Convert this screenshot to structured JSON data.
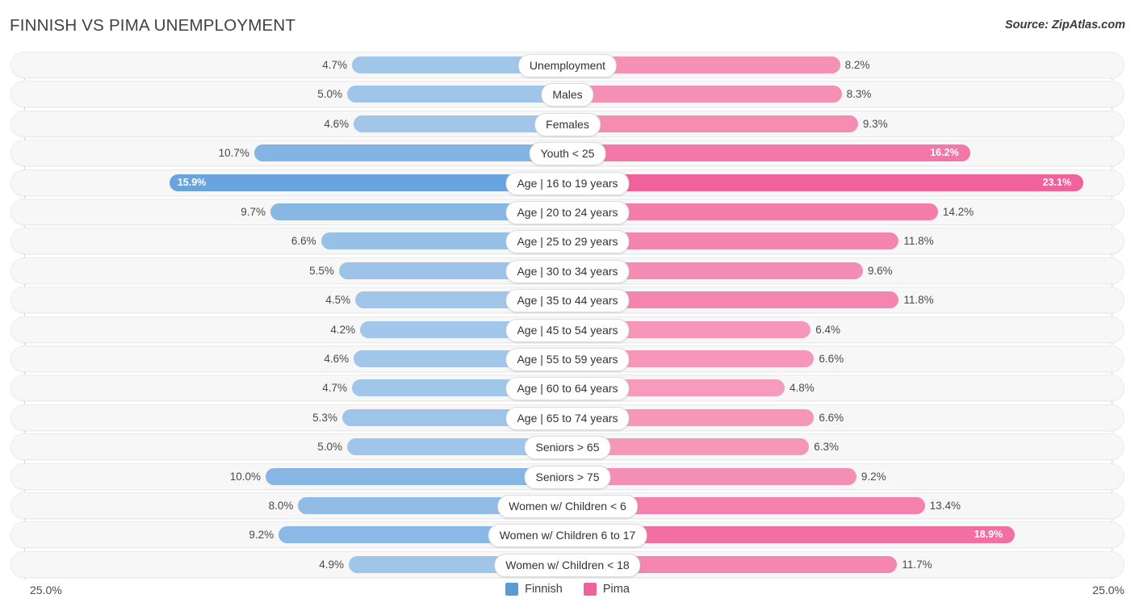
{
  "header": {
    "title": "FINNISH VS PIMA UNEMPLOYMENT",
    "source": "Source: ZipAtlas.com"
  },
  "axis": {
    "min_label": "25.0%",
    "max_label": "25.0%"
  },
  "legend": {
    "items": [
      {
        "label": "Finnish",
        "color": "#5b9bd5"
      },
      {
        "label": "Pima",
        "color": "#f0629a"
      }
    ]
  },
  "colors": {
    "finnish_light": "#a4c8ea",
    "finnish_dark": "#6aa4de",
    "pima_light": "#f79ebd",
    "pima_dark": "#f0629a",
    "track": "#f7f7f7",
    "pill": "#ffffff"
  },
  "chart_data": {
    "type": "bar",
    "title": "FINNISH VS PIMA UNEMPLOYMENT",
    "subtitle": "",
    "orientation": "horizontal-diverging",
    "xlabel": "",
    "ylabel": "",
    "xlim": [
      25.0,
      25.0
    ],
    "grid": false,
    "legend_position": "bottom-center",
    "categories": [
      "Unemployment",
      "Males",
      "Females",
      "Youth < 25",
      "Age | 16 to 19 years",
      "Age | 20 to 24 years",
      "Age | 25 to 29 years",
      "Age | 30 to 34 years",
      "Age | 35 to 44 years",
      "Age | 45 to 54 years",
      "Age | 55 to 59 years",
      "Age | 60 to 64 years",
      "Age | 65 to 74 years",
      "Seniors > 65",
      "Seniors > 75",
      "Women w/ Children < 6",
      "Women w/ Children 6 to 17",
      "Women w/ Children < 18"
    ],
    "series": [
      {
        "name": "Finnish",
        "values": [
          4.7,
          5.0,
          4.6,
          10.7,
          15.9,
          9.7,
          6.6,
          5.5,
          4.5,
          4.2,
          4.6,
          4.7,
          5.3,
          5.0,
          10.0,
          8.0,
          9.2,
          4.9
        ],
        "labels": [
          "4.7%",
          "5.0%",
          "4.6%",
          "10.7%",
          "15.9%",
          "9.7%",
          "6.6%",
          "5.5%",
          "4.5%",
          "4.2%",
          "4.6%",
          "4.7%",
          "5.3%",
          "5.0%",
          "10.0%",
          "8.0%",
          "9.2%",
          "4.9%"
        ]
      },
      {
        "name": "Pima",
        "values": [
          8.2,
          8.3,
          9.3,
          16.2,
          23.1,
          14.2,
          11.8,
          9.6,
          11.8,
          6.4,
          6.6,
          4.8,
          6.6,
          6.3,
          9.2,
          13.4,
          18.9,
          11.7
        ],
        "labels": [
          "8.2%",
          "8.3%",
          "9.3%",
          "16.2%",
          "23.1%",
          "14.2%",
          "11.8%",
          "9.6%",
          "11.8%",
          "6.4%",
          "6.6%",
          "4.8%",
          "6.6%",
          "6.3%",
          "9.2%",
          "13.4%",
          "18.9%",
          "11.7%"
        ]
      }
    ]
  }
}
